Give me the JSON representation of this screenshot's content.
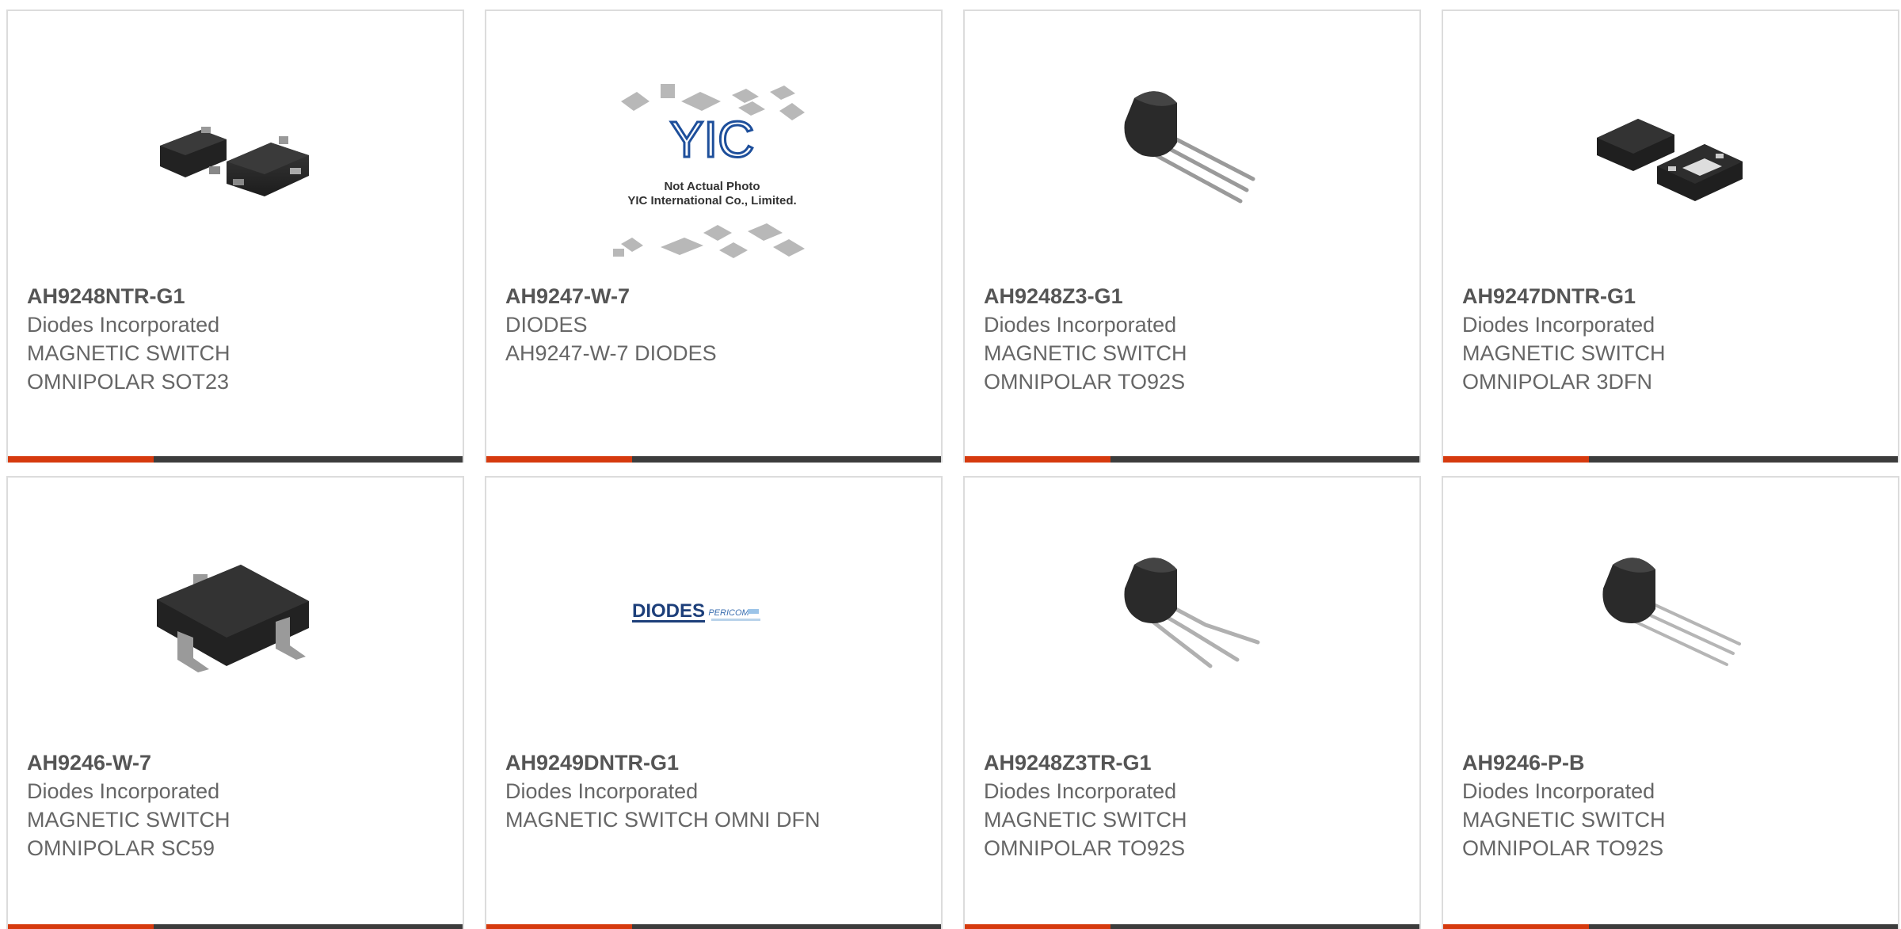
{
  "products": [
    {
      "pn": "AH9248NTR-G1",
      "mfr": "Diodes Incorporated",
      "desc1": "MAGNETIC SWITCH",
      "desc2": "OMNIPOLAR SOT23",
      "image": "sot23-package"
    },
    {
      "pn": "AH9247-W-7",
      "mfr": "DIODES",
      "desc1": "AH9247-W-7 DIODES",
      "desc2": "",
      "image": "yic-placeholder",
      "placeholder": {
        "logo": "YIC",
        "line1": "Not Actual Photo",
        "line2": "YIC International Co., Limited."
      }
    },
    {
      "pn": "AH9248Z3-G1",
      "mfr": "Diodes Incorporated",
      "desc1": "MAGNETIC SWITCH",
      "desc2": "OMNIPOLAR TO92S",
      "image": "to92-package"
    },
    {
      "pn": "AH9247DNTR-G1",
      "mfr": "Diodes Incorporated",
      "desc1": "MAGNETIC SWITCH",
      "desc2": "OMNIPOLAR 3DFN",
      "image": "dfn-package"
    },
    {
      "pn": "AH9246-W-7",
      "mfr": "Diodes Incorporated",
      "desc1": "MAGNETIC SWITCH",
      "desc2": "OMNIPOLAR SC59",
      "image": "sc59-package"
    },
    {
      "pn": "AH9249DNTR-G1",
      "mfr": "Diodes Incorporated",
      "desc1": "MAGNETIC SWITCH OMNI DFN",
      "desc2": "",
      "image": "diodes-logo",
      "logo": {
        "brand": "DIODES",
        "sub": "PERICOM"
      }
    },
    {
      "pn": "AH9248Z3TR-G1",
      "mfr": "Diodes Incorporated",
      "desc1": "MAGNETIC SWITCH",
      "desc2": "OMNIPOLAR TO92S",
      "image": "to92-bent-package"
    },
    {
      "pn": "AH9246-P-B",
      "mfr": "Diodes Incorporated",
      "desc1": "MAGNETIC SWITCH",
      "desc2": "OMNIPOLAR TO92S",
      "image": "to92-package"
    }
  ],
  "colors": {
    "accent": "#d63a0e",
    "bar": "#3c3c3c",
    "border": "#dcdcdc",
    "text": "#666666"
  }
}
